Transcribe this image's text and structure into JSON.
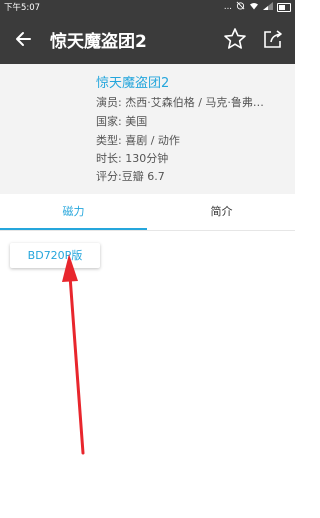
{
  "status_bar": {
    "time": "下午5:07",
    "dots": "..."
  },
  "app_bar": {
    "title": "惊天魔盗团2",
    "back_icon": "arrow-left-icon",
    "favorite_icon": "star-outline-icon",
    "share_icon": "share-icon"
  },
  "movie": {
    "name": "惊天魔盗团2",
    "cast": "演员: 杰西·艾森伯格 / 马克·鲁弗…",
    "country": "国家: 美国",
    "genre": "类型: 喜剧 / 动作",
    "duration": "时长: 130分钟",
    "rating": "评分:豆瓣 6.7"
  },
  "tabs": [
    {
      "label": "磁力",
      "active": true
    },
    {
      "label": "简介",
      "active": false
    }
  ],
  "magnet_items": [
    {
      "label": "BD720P版"
    }
  ],
  "colors": {
    "accent": "#25a6dc",
    "app_bar": "#3b3b3b",
    "annotation_arrow": "#e8262d"
  }
}
